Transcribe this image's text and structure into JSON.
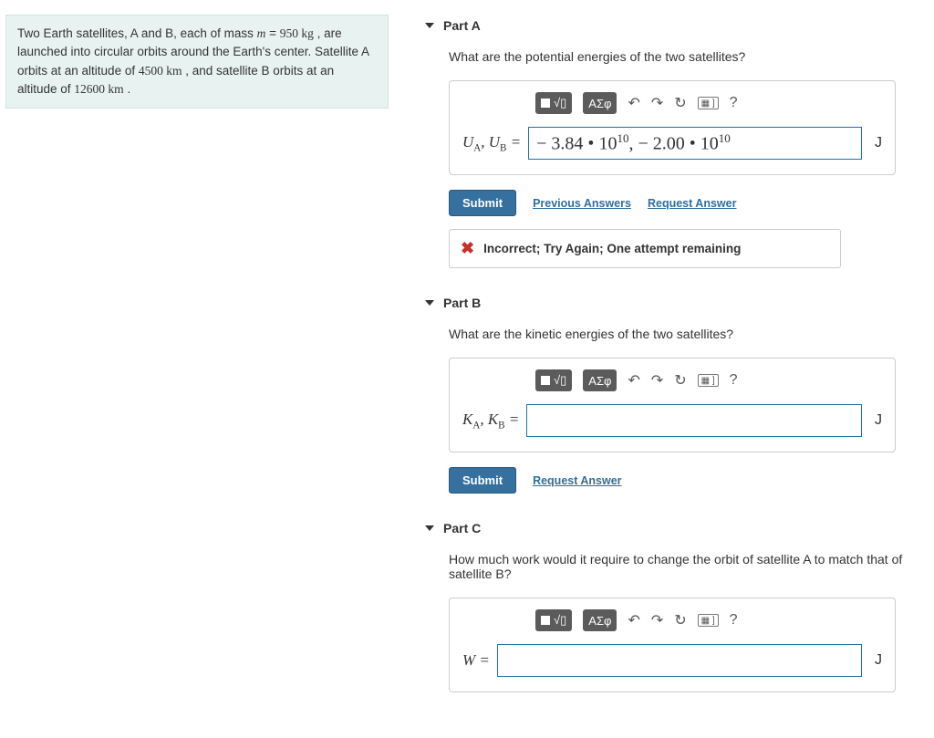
{
  "problem": {
    "line1_a": "Two Earth satellites, A and B, each of mass ",
    "mass_var": "m",
    "eq": " = ",
    "mass_val": "950",
    "mass_unit": " kg",
    "line1_b": " , are launched into circular orbits around the Earth's center. Satellite A orbits at an altitude of ",
    "altA": "4500",
    "km": " km",
    "line1_c": " , and satellite B orbits at an altitude of ",
    "altB": "12600",
    "line1_d": " ."
  },
  "toolbar": {
    "templates": "■",
    "fraction": "√▯",
    "greek": "ΑΣφ",
    "undo": "↶",
    "redo": "↷",
    "reset": "↻",
    "keyboard": "⌨",
    "help": "?"
  },
  "parts": {
    "A": {
      "title": "Part A",
      "prompt": "What are the potential energies of the two satellites?",
      "label_html": "UA_UB",
      "value": "− 3.84 • 10¹⁰, − 2.00 • 10¹⁰",
      "unit": "J",
      "submit": "Submit",
      "prev": "Previous Answers",
      "req": "Request Answer",
      "feedback": "Incorrect; Try Again; One attempt remaining"
    },
    "B": {
      "title": "Part B",
      "prompt": "What are the kinetic energies of the two satellites?",
      "unit": "J",
      "submit": "Submit",
      "req": "Request Answer"
    },
    "C": {
      "title": "Part C",
      "prompt": "How much work would it require to change the orbit of satellite A to match that of satellite B?",
      "label": "W",
      "unit": "J"
    }
  }
}
